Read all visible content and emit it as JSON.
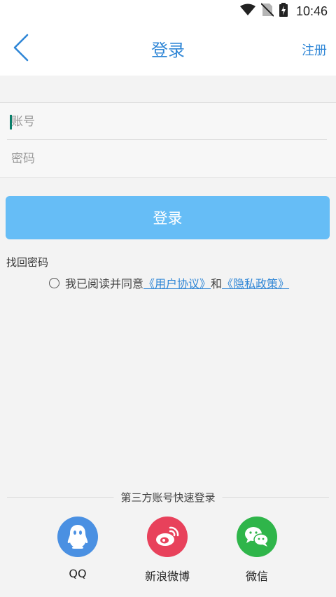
{
  "status_bar": {
    "time": "10:46"
  },
  "header": {
    "title": "登录",
    "register_label": "注册"
  },
  "form": {
    "account_placeholder": "账号",
    "password_placeholder": "密码"
  },
  "login_button_label": "登录",
  "forgot_password_label": "找回密码",
  "agreement": {
    "prefix": "我已阅读并同意",
    "user_agreement": "《用户协议》",
    "connector": "和",
    "privacy_policy": "《隐私政策》"
  },
  "third_party": {
    "divider_text": "第三方账号快速登录",
    "items": [
      {
        "label": "QQ",
        "icon": "qq-icon",
        "color": "#4a90e2"
      },
      {
        "label": "新浪微博",
        "icon": "weibo-icon",
        "color": "#e8415b"
      },
      {
        "label": "微信",
        "icon": "wechat-icon",
        "color": "#2fb54a"
      }
    ]
  },
  "colors": {
    "accent": "#2f86d6",
    "login_button": "#66bdf6",
    "background": "#f3f3f3"
  }
}
